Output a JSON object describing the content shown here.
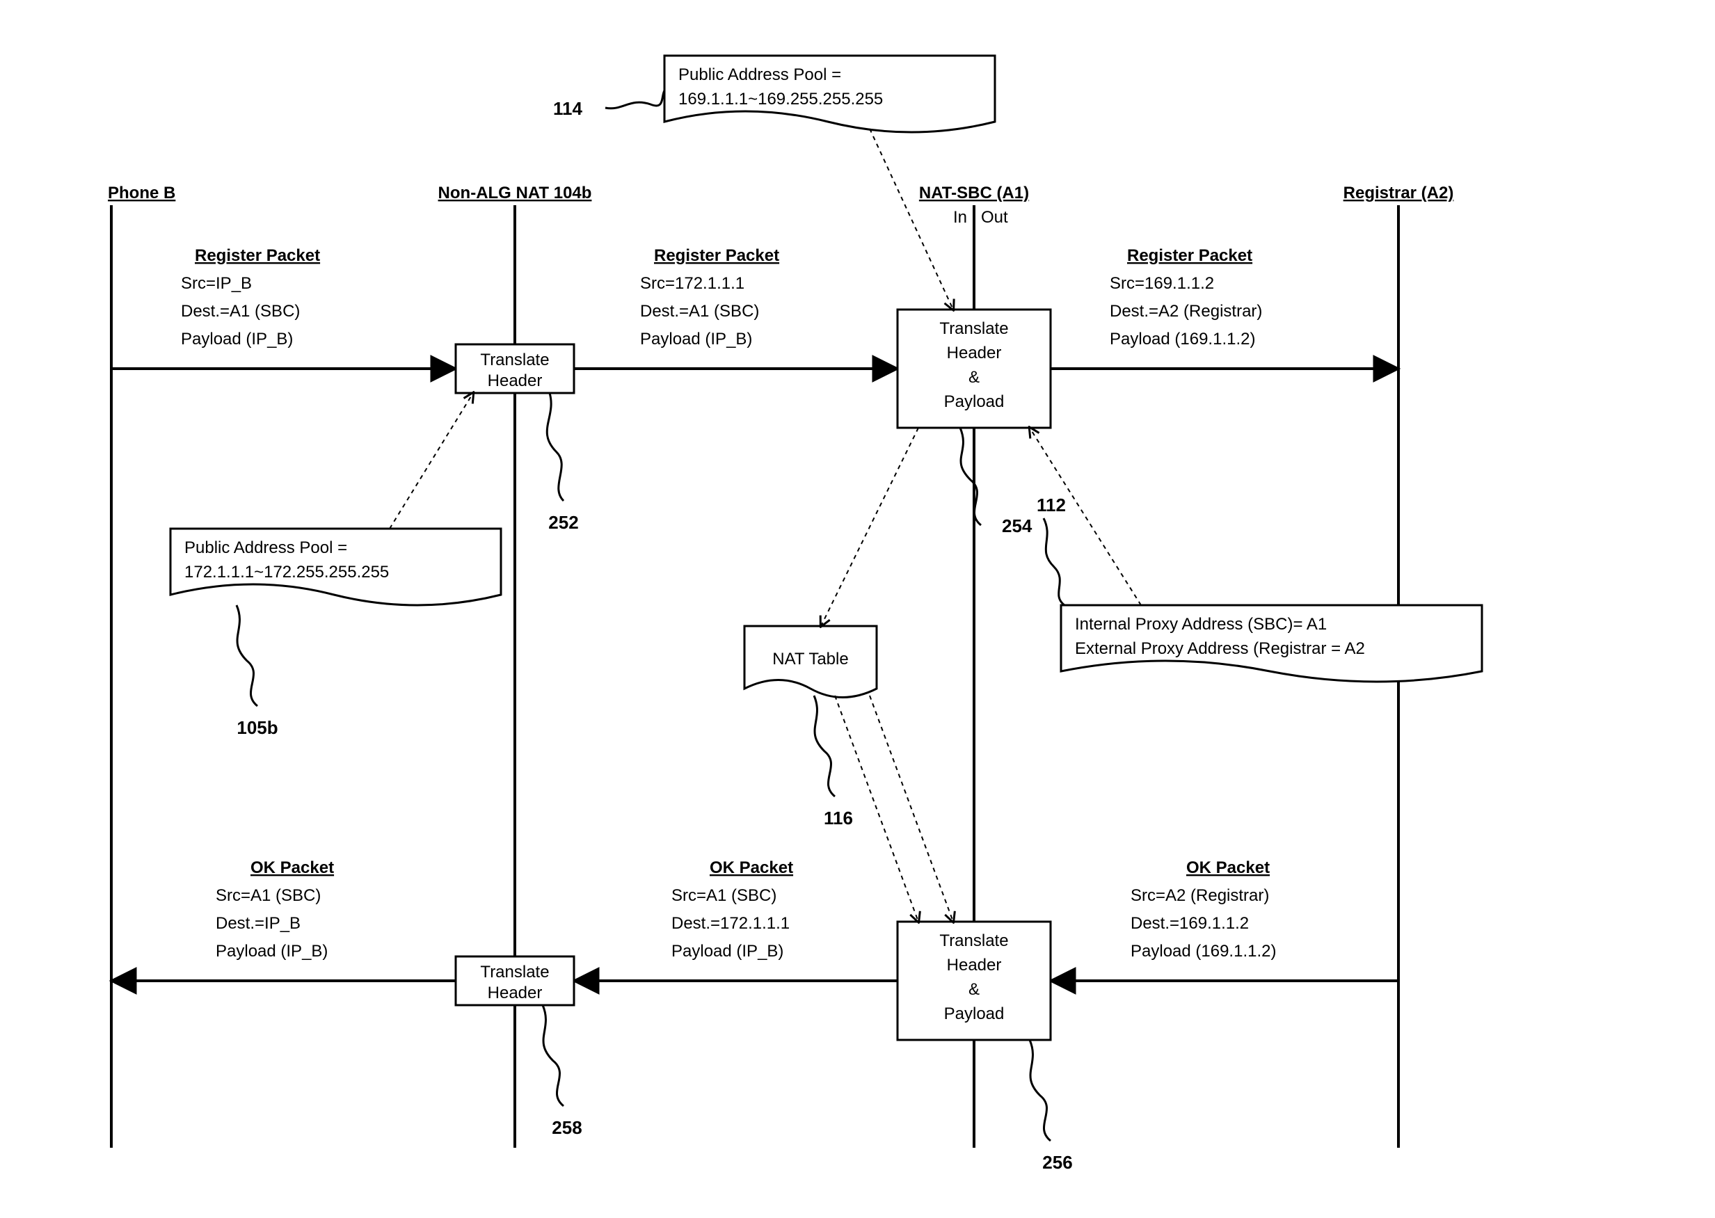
{
  "lifelines": {
    "phoneB": "Phone B",
    "nat": "Non-ALG NAT 104b",
    "sbc": "NAT-SBC (A1)",
    "sbcIn": "In",
    "sbcOut": "Out",
    "registrar": "Registrar (A2)"
  },
  "boxes": {
    "translateHeader1": {
      "l1": "Translate",
      "l2": "Header"
    },
    "translateHP1": {
      "l1": "Translate",
      "l2": "Header",
      "l3": "&",
      "l4": "Payload"
    },
    "translateHeader2": {
      "l1": "Translate",
      "l2": "Header"
    },
    "translateHP2": {
      "l1": "Translate",
      "l2": "Header",
      "l3": "&",
      "l4": "Payload"
    },
    "natTable": "NAT Table"
  },
  "notes": {
    "pool114": {
      "l1": "Public Address Pool =",
      "l2": "169.1.1.1~169.255.255.255"
    },
    "pool105b": {
      "l1": "Public Address Pool =",
      "l2": "172.1.1.1~172.255.255.255"
    },
    "proxy112": {
      "l1": "Internal Proxy Address (SBC)= A1",
      "l2": "External Proxy Address (Registrar = A2"
    }
  },
  "packets": {
    "reg1": {
      "title": "Register Packet",
      "l1": "Src=IP_B",
      "l2": "Dest.=A1 (SBC)",
      "l3": "Payload (IP_B)"
    },
    "reg2": {
      "title": "Register  Packet",
      "l1": "Src=172.1.1.1",
      "l2": "Dest.=A1 (SBC)",
      "l3": "Payload (IP_B)"
    },
    "reg3": {
      "title": "Register Packet",
      "l1": "Src=169.1.1.2",
      "l2": "Dest.=A2 (Registrar)",
      "l3": "Payload (169.1.1.2)"
    },
    "ok1": {
      "title": "OK Packet",
      "l1": "Src=A2 (Registrar)",
      "l2": "Dest.=169.1.1.2",
      "l3": "Payload (169.1.1.2)"
    },
    "ok2": {
      "title": "OK Packet",
      "l1": "Src=A1 (SBC)",
      "l2": "Dest.=172.1.1.1",
      "l3": "Payload (IP_B)"
    },
    "ok3": {
      "title": "OK Packet",
      "l1": "Src=A1 (SBC)",
      "l2": "Dest.=IP_B",
      "l3": "Payload (IP_B)"
    }
  },
  "refs": {
    "r114": "114",
    "r105b": "105b",
    "r252": "252",
    "r254": "254",
    "r112": "112",
    "r116": "116",
    "r258": "258",
    "r256": "256"
  }
}
